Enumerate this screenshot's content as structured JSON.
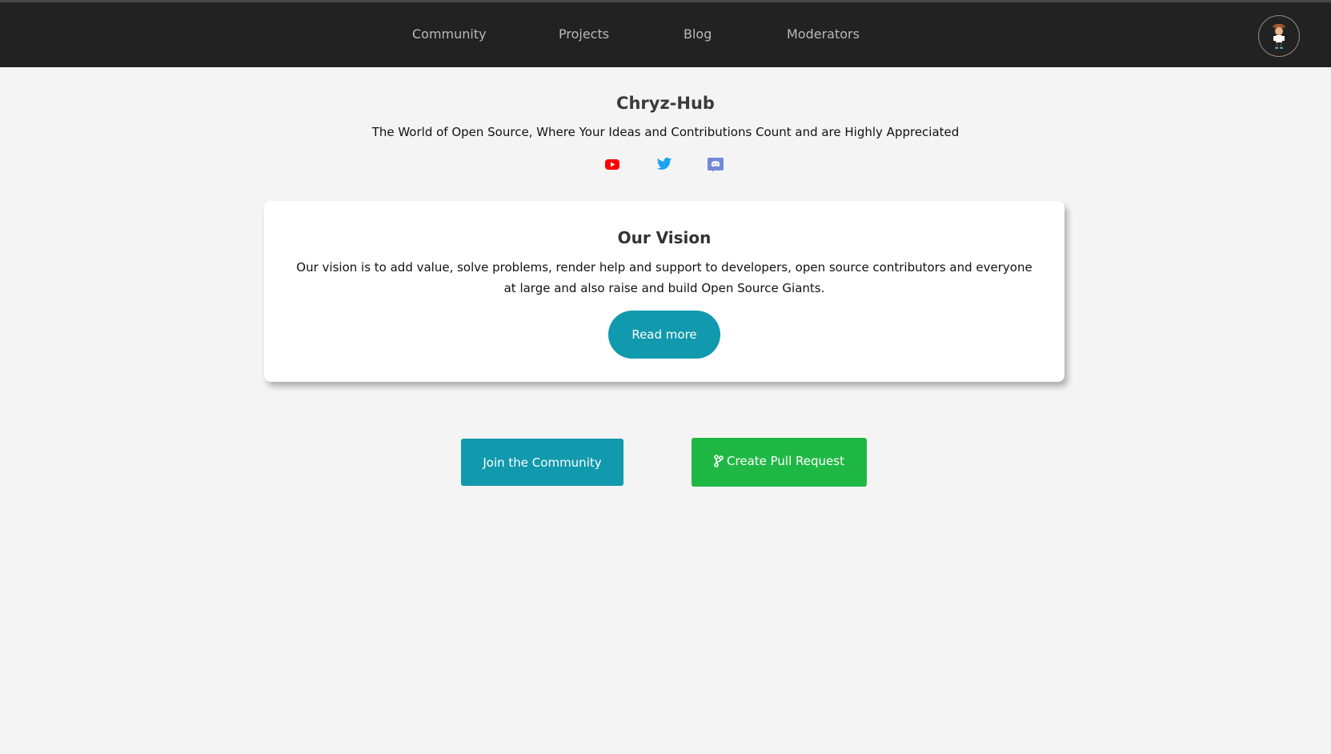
{
  "nav": {
    "items": [
      {
        "label": "Community"
      },
      {
        "label": "Projects"
      },
      {
        "label": "Blog"
      },
      {
        "label": "Moderators"
      }
    ],
    "avatar_icon": "user-avatar"
  },
  "hero": {
    "title": "Chryz-Hub",
    "subtitle": "The World of Open Source, Where Your Ideas and Contributions Count and are Highly Appreciated",
    "social": [
      {
        "icon": "youtube-icon",
        "color": "#ff0000"
      },
      {
        "icon": "twitter-icon",
        "color": "#1da1f2"
      },
      {
        "icon": "discord-icon",
        "color": "#7289da"
      }
    ]
  },
  "vision": {
    "title": "Our Vision",
    "text": "Our vision is to add value, solve problems, render help and support to developers, open source contributors and everyone at large and also raise and build Open Source Giants.",
    "button_label": "Read more"
  },
  "actions": {
    "join_label": "Join the Community",
    "pr_label": "Create Pull Request",
    "pr_icon": "git-branch-icon"
  },
  "colors": {
    "navbar": "#222222",
    "accent_teal": "#1199ad",
    "accent_green": "#20b845",
    "background": "#f4f4f4"
  }
}
